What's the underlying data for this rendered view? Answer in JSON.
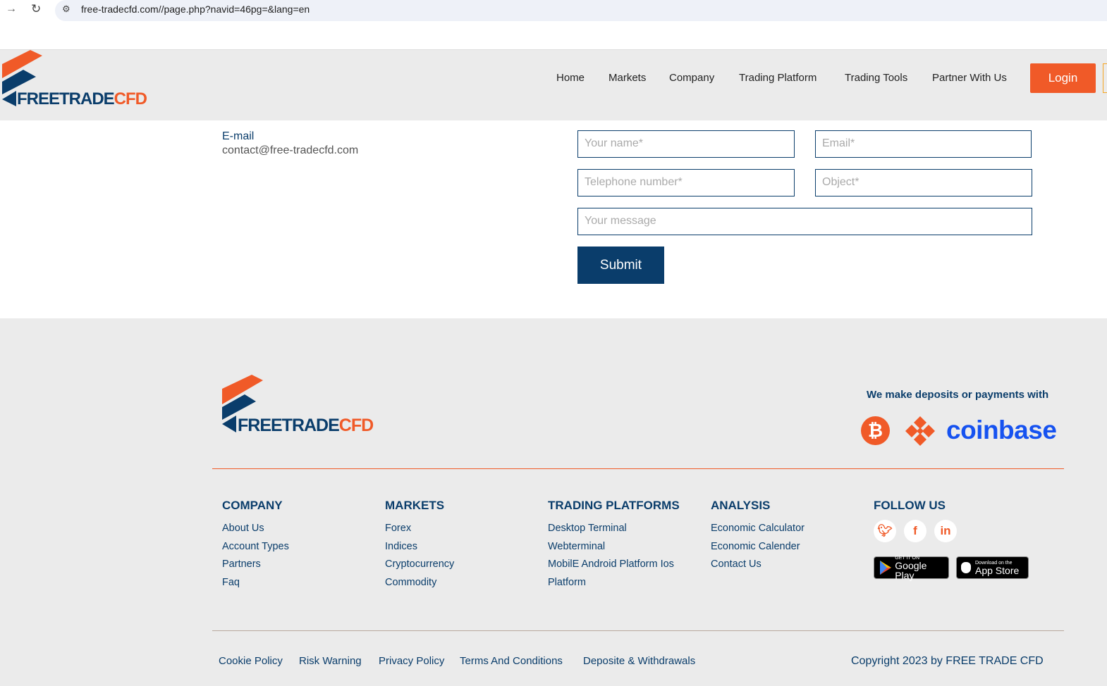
{
  "browser": {
    "url": "free-tradecfd.com//page.php?navid=46pg=&lang=en"
  },
  "logo": {
    "part1": "FREETRADE",
    "part2": "CFD"
  },
  "nav": {
    "items": [
      "Home",
      "Markets",
      "Company",
      "Trading Platform",
      "Trading Tools",
      "Partner With Us"
    ],
    "login": "Login"
  },
  "contact": {
    "email_label": "E-mail",
    "email_value": "contact@free-tradecfd.com"
  },
  "form": {
    "name_placeholder": "Your name*",
    "email_placeholder": "Email*",
    "phone_placeholder": "Telephone number*",
    "object_placeholder": "Object*",
    "message_placeholder": "Your message",
    "submit": "Submit"
  },
  "footer": {
    "payments_label": "We make deposits or payments with",
    "coinbase": "coinbase",
    "columns": [
      {
        "title": "COMPANY",
        "links": [
          "About Us",
          "Account Types",
          "Partners",
          "Faq"
        ]
      },
      {
        "title": "MARKETS",
        "links": [
          "Forex",
          "Indices",
          "Cryptocurrency",
          "Commodity"
        ]
      },
      {
        "title": "TRADING PLATFORMS",
        "links": [
          "Desktop Terminal",
          "Webterminal",
          "MobilE Android Platform Ios",
          "Platform"
        ]
      },
      {
        "title": "ANALYSIS",
        "links": [
          "Economic Calculator",
          "Economic Calender",
          "Contact Us"
        ]
      }
    ],
    "follow": "FOLLOW US",
    "google_small": "GET IT ON",
    "google_big": "Google Play",
    "apple_small": "Download on the",
    "apple_big": "App Store",
    "bottom_links": [
      "Cookie Policy",
      "Risk Warning",
      "Privacy Policy",
      "Terms And Conditions",
      "Deposite & Withdrawals"
    ],
    "copyright": "Copyright 2023 by FREE TRADE CFD"
  },
  "colors": {
    "brand_blue": "#0a3d6b",
    "brand_orange": "#f05a28",
    "coinbase": "#1652f0"
  }
}
